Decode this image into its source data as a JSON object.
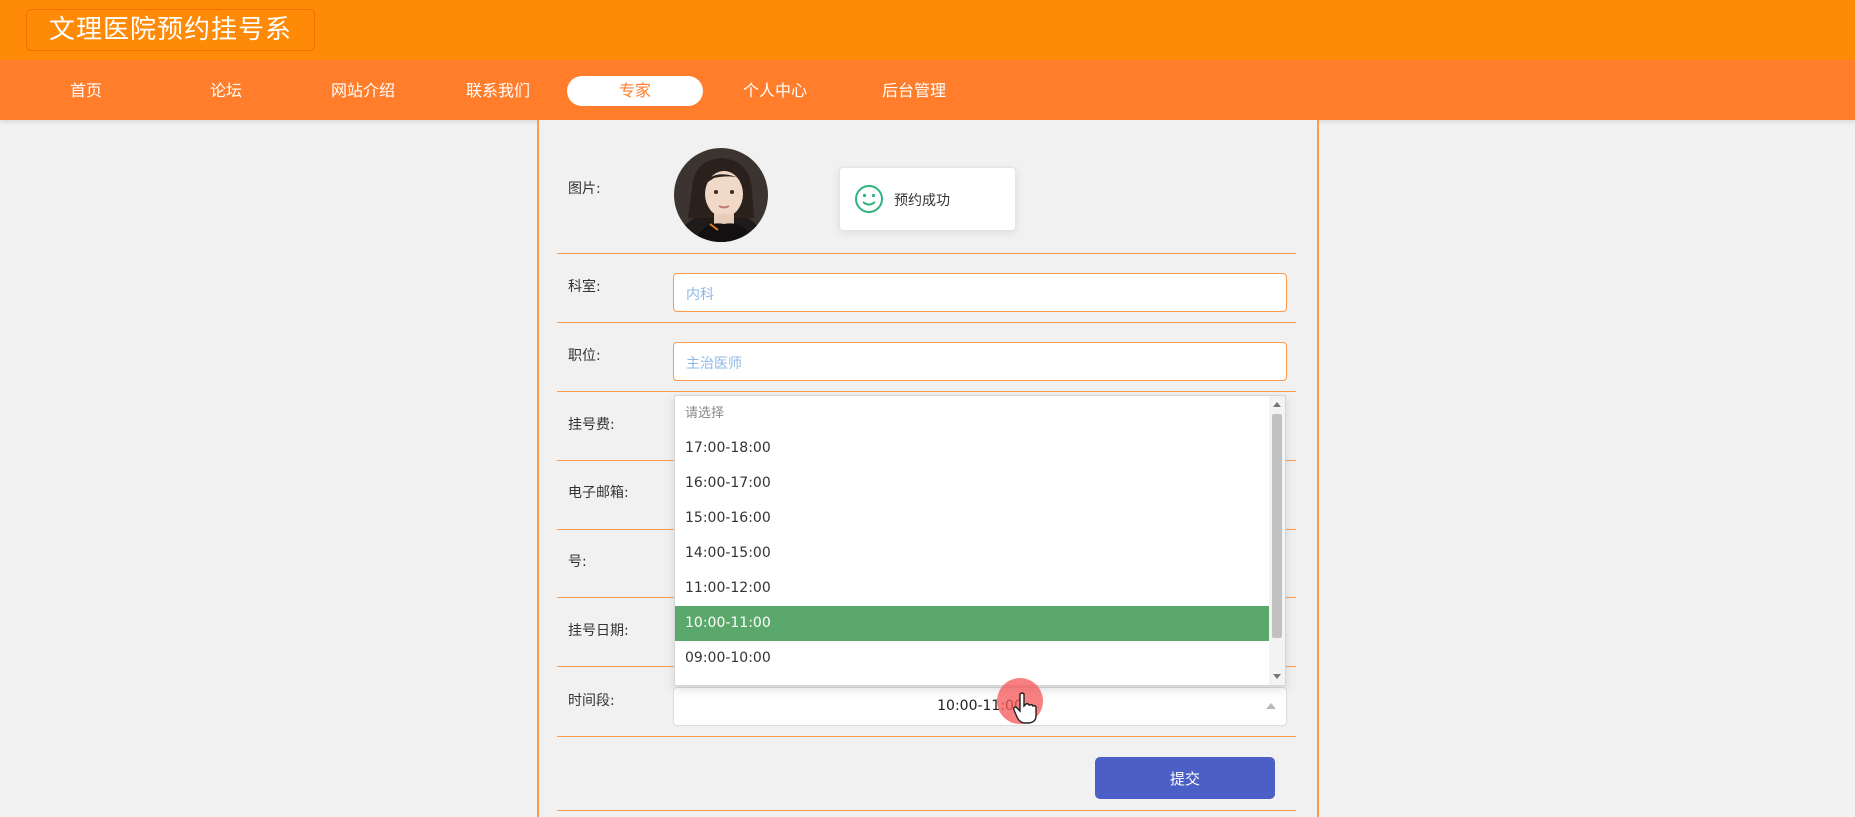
{
  "header": {
    "title": "文理医院预约挂号系"
  },
  "nav": {
    "items": [
      {
        "label": "首页"
      },
      {
        "label": "论坛"
      },
      {
        "label": "网站介绍"
      },
      {
        "label": "联系我们"
      },
      {
        "label": "专家",
        "active": true
      },
      {
        "label": "个人中心"
      },
      {
        "label": "后台管理"
      }
    ]
  },
  "form": {
    "image_label": "图片:",
    "toast": {
      "text": "预约成功",
      "icon": "smile-icon",
      "color": "#2db37d"
    },
    "department": {
      "label": "科室:",
      "value": "内科"
    },
    "position": {
      "label": "职位:",
      "value": "主治医师"
    },
    "fee": {
      "label": "挂号费:"
    },
    "email": {
      "label": "电子邮箱:"
    },
    "number": {
      "label": "号:"
    },
    "date": {
      "label": "挂号日期:"
    },
    "timeslot": {
      "label": "时间段:",
      "selected": "10:00-11:00",
      "placeholder": "请选择",
      "options": [
        "17:00-18:00",
        "16:00-17:00",
        "15:00-16:00",
        "14:00-15:00",
        "11:00-12:00",
        "10:00-11:00",
        "09:00-10:00"
      ]
    },
    "submit_label": "提交"
  },
  "colors": {
    "header": "#ff8a07",
    "navbar": "#ff7d2b",
    "border_accent": "#ff9a4d",
    "selected_option": "#5aa86b",
    "submit": "#4b5fc6"
  }
}
